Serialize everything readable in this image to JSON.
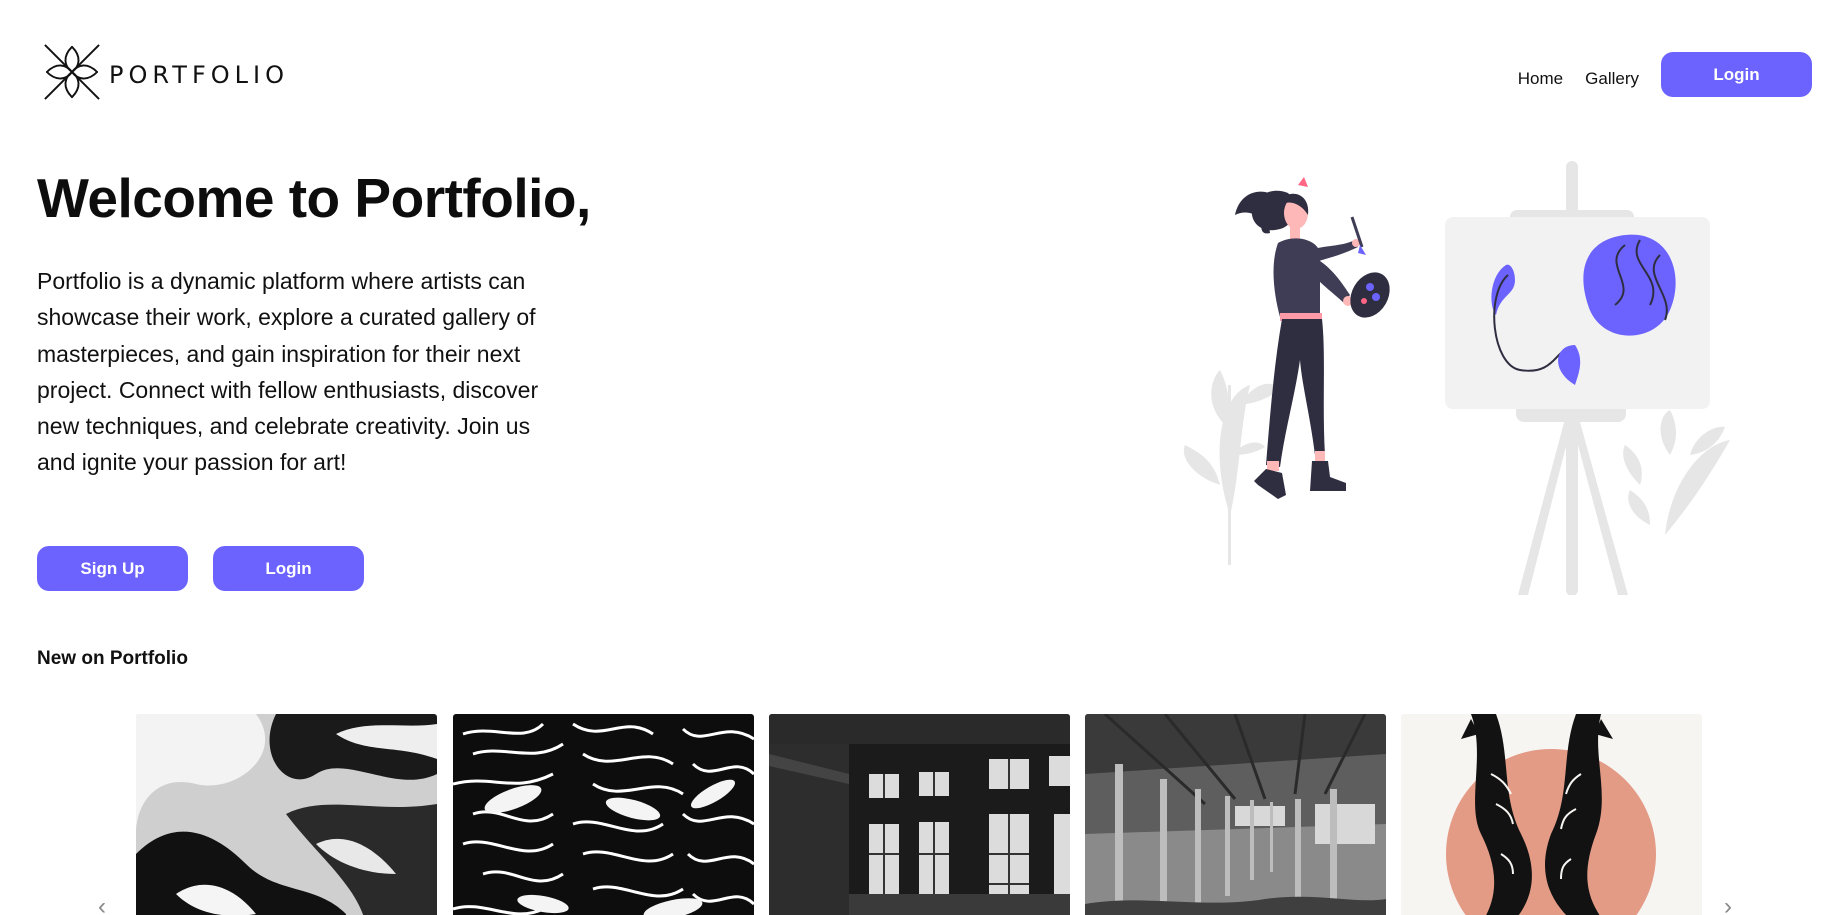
{
  "brand": {
    "name": "PORTFOLIO",
    "logo_icon": "floral-x-logo-icon"
  },
  "nav": {
    "links": [
      {
        "label": "Home"
      },
      {
        "label": "Gallery"
      }
    ],
    "login_label": "Login"
  },
  "hero": {
    "title": "Welcome to Portfolio,",
    "description": "Portfolio is a dynamic platform where artists can showcase their work, explore a curated gallery of masterpieces, and gain inspiration for their next project. Connect with fellow enthusiasts, discover new techniques, and celebrate creativity. Join us and ignite your passion for art!",
    "signup_label": "Sign Up",
    "login_label": "Login",
    "illustration": "woman-painting-on-easel-illustration"
  },
  "new_section": {
    "title": "New on Portfolio",
    "cards": [
      {
        "image": "abstract-bw-liquid"
      },
      {
        "image": "bw-leaf-pattern"
      },
      {
        "image": "abandoned-factory-windows"
      },
      {
        "image": "abandoned-warehouse-columns"
      },
      {
        "image": "koi-fish-linocut"
      }
    ]
  },
  "colors": {
    "accent": "#6c63ff",
    "text": "#111111",
    "background": "#ffffff"
  }
}
